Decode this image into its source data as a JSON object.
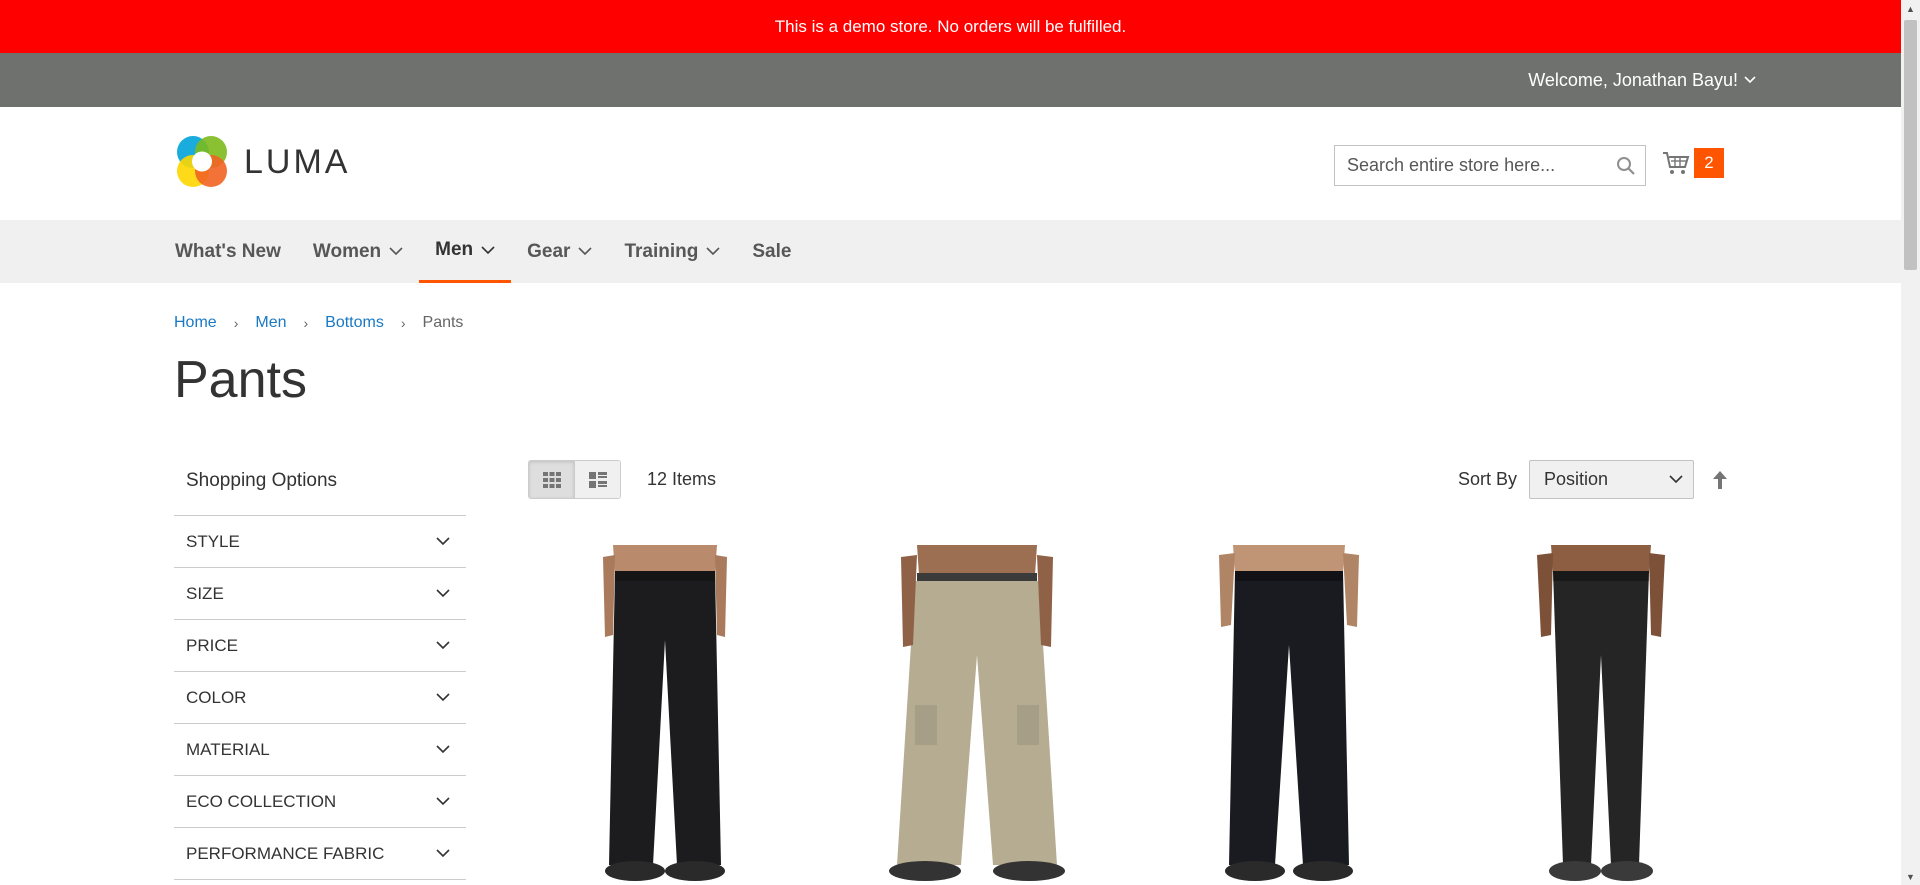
{
  "demo_notice": "This is a demo store. No orders will be fulfilled.",
  "top_panel": {
    "welcome": "Welcome, Jonathan Bayu!"
  },
  "logo": {
    "text": "LUMA"
  },
  "search": {
    "placeholder": "Search entire store here...",
    "value": ""
  },
  "cart": {
    "count": "2",
    "icon": "cart-icon"
  },
  "nav": {
    "items": [
      {
        "label": "What's New"
      },
      {
        "label": "Women"
      },
      {
        "label": "Men"
      },
      {
        "label": "Gear"
      },
      {
        "label": "Training"
      },
      {
        "label": "Sale"
      }
    ]
  },
  "breadcrumbs": {
    "home": "Home",
    "men": "Men",
    "bottoms": "Bottoms",
    "current": "Pants"
  },
  "page_title": "Pants",
  "sidebar": {
    "title": "Shopping Options",
    "filters": [
      "STYLE",
      "SIZE",
      "PRICE",
      "COLOR",
      "MATERIAL",
      "ECO COLLECTION",
      "PERFORMANCE FABRIC"
    ]
  },
  "toolbar": {
    "amount": "12 Items",
    "sort_label": "Sort By",
    "sort_value": "Position"
  },
  "products": [
    {
      "pants_color": "#1c1c1e",
      "shoe_color": "#2a2a2a"
    },
    {
      "pants_color": "#b5ac92",
      "shoe_color": "#333333"
    },
    {
      "pants_color": "#1a1b20",
      "shoe_color": "#2a2a2a"
    },
    {
      "pants_color": "#252525",
      "shoe_color": "#3a3a3a"
    }
  ],
  "colors": {
    "demo_bar": "#ff0000",
    "top_panel": "#6e716e",
    "accent": "#ff5501",
    "link": "#1979c3",
    "nav_bg": "#f0f0f0"
  }
}
